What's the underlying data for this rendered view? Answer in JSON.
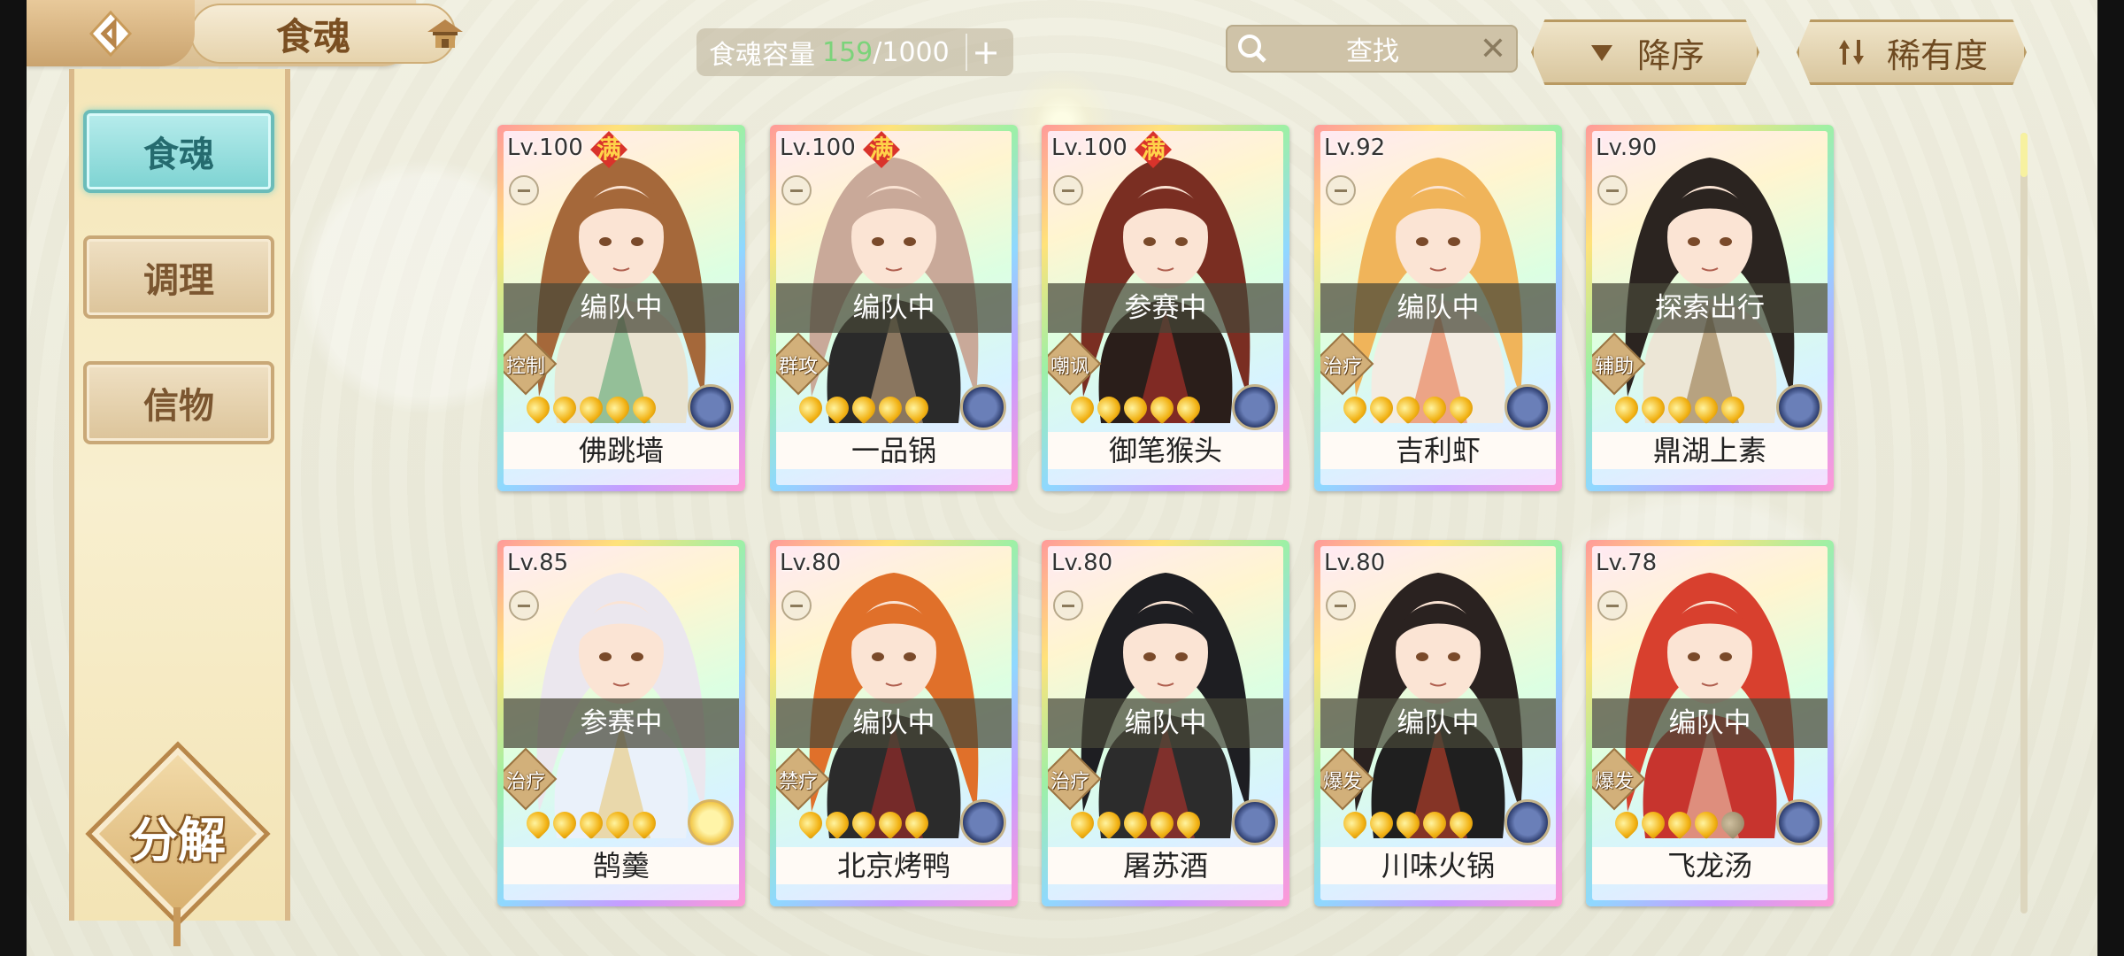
{
  "header": {
    "title": "食魂",
    "capacity_label": "食魂容量",
    "capacity_used": "159",
    "capacity_total": "/1000",
    "search_placeholder": "查找",
    "sort_label": "降序",
    "rarity_label": "稀有度"
  },
  "sidebar": {
    "tabs": [
      {
        "label": "食魂",
        "active": true
      },
      {
        "label": "调理",
        "active": false
      },
      {
        "label": "信物",
        "active": false
      }
    ],
    "decompose_label": "分解"
  },
  "cards": [
    {
      "level": "Lv.100",
      "max": true,
      "max_label": "满",
      "status": "编队中",
      "role": "控制",
      "name": "佛跳墙",
      "stars": 5,
      "element": "blue",
      "palette": {
        "hair": "#a5683a",
        "cloth": "#e9e3d0",
        "accent": "#4fa36a"
      }
    },
    {
      "level": "Lv.100",
      "max": true,
      "max_label": "满",
      "status": "编队中",
      "role": "群攻",
      "name": "一品锅",
      "stars": 5,
      "element": "blue",
      "palette": {
        "hair": "#c9a999",
        "cloth": "#2a2a2a",
        "accent": "#d8b48a"
      }
    },
    {
      "level": "Lv.100",
      "max": true,
      "max_label": "满",
      "status": "参赛中",
      "role": "嘲讽",
      "name": "御笔猴头",
      "stars": 5,
      "element": "blue",
      "palette": {
        "hair": "#7a2e22",
        "cloth": "#2a1e1a",
        "accent": "#c7342e"
      }
    },
    {
      "level": "Lv.92",
      "max": false,
      "max_label": "",
      "status": "编队中",
      "role": "治疗",
      "name": "吉利虾",
      "stars": 5,
      "element": "blue",
      "palette": {
        "hair": "#f0b45a",
        "cloth": "#f3ece2",
        "accent": "#e56a3a"
      }
    },
    {
      "level": "Lv.90",
      "max": false,
      "max_label": "",
      "status": "探索出行",
      "role": "辅助",
      "name": "鼎湖上素",
      "stars": 5,
      "element": "blue",
      "palette": {
        "hair": "#2b2420",
        "cloth": "#ece6d6",
        "accent": "#8c6a3a"
      }
    },
    {
      "level": "Lv.85",
      "max": false,
      "max_label": "",
      "status": "参赛中",
      "role": "治疗",
      "name": "鹄羹",
      "stars": 5,
      "element": "gold",
      "palette": {
        "hair": "#ebe7ee",
        "cloth": "#eaf1fa",
        "accent": "#e7c26a"
      }
    },
    {
      "level": "Lv.80",
      "max": false,
      "max_label": "",
      "status": "编队中",
      "role": "禁疗",
      "name": "北京烤鸭",
      "stars": 5,
      "element": "blue",
      "palette": {
        "hair": "#e0702a",
        "cloth": "#2b2b2b",
        "accent": "#b22a28"
      }
    },
    {
      "level": "Lv.80",
      "max": false,
      "max_label": "",
      "status": "编队中",
      "role": "治疗",
      "name": "屠苏酒",
      "stars": 5,
      "element": "blue",
      "palette": {
        "hair": "#1e1e22",
        "cloth": "#2c2c2c",
        "accent": "#c7342e"
      }
    },
    {
      "level": "Lv.80",
      "max": false,
      "max_label": "",
      "status": "编队中",
      "role": "爆发",
      "name": "川味火锅",
      "stars": 5,
      "element": "blue",
      "palette": {
        "hair": "#2a2220",
        "cloth": "#1f1f1f",
        "accent": "#d9462c"
      }
    },
    {
      "level": "Lv.78",
      "max": false,
      "max_label": "",
      "status": "编队中",
      "role": "爆发",
      "name": "飞龙汤",
      "stars": 4,
      "element": "blue",
      "palette": {
        "hair": "#d8402e",
        "cloth": "#c7342e",
        "accent": "#f0d8c0"
      }
    }
  ]
}
